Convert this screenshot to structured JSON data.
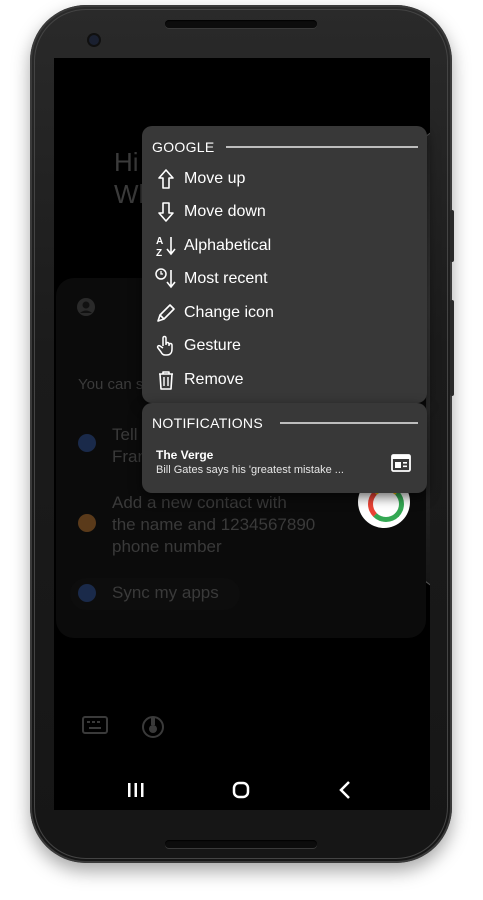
{
  "background_ghost": {
    "greeting_line1": "Hi",
    "greeting_line2": "Wh",
    "hint_text": "You can s",
    "item_tell_line1": "Tell",
    "item_tell_line2": "Fran",
    "item_contact_line1": "Add a new contact with",
    "item_contact_line2": "the name and 1234567890",
    "item_contact_line3": "phone number",
    "item_sync": "Sync my apps"
  },
  "google_menu": {
    "title": "GOOGLE",
    "items": [
      {
        "label": "Move up",
        "icon": "arrow-up-icon"
      },
      {
        "label": "Move down",
        "icon": "arrow-down-icon"
      },
      {
        "label": "Alphabetical",
        "icon": "sort-alphabetical-icon"
      },
      {
        "label": "Most recent",
        "icon": "sort-recent-icon"
      },
      {
        "label": "Change icon",
        "icon": "pencil-icon"
      },
      {
        "label": "Gesture",
        "icon": "hand-pointer-icon"
      },
      {
        "label": "Remove",
        "icon": "trash-icon"
      }
    ]
  },
  "notifications": {
    "title": "NOTIFICATIONS",
    "item": {
      "source": "The Verge",
      "text": "Bill Gates says his 'greatest mistake ..."
    }
  },
  "colors": {
    "menu_bg": "#383838",
    "text": "#ffffff",
    "divider": "#bdbdbd"
  }
}
